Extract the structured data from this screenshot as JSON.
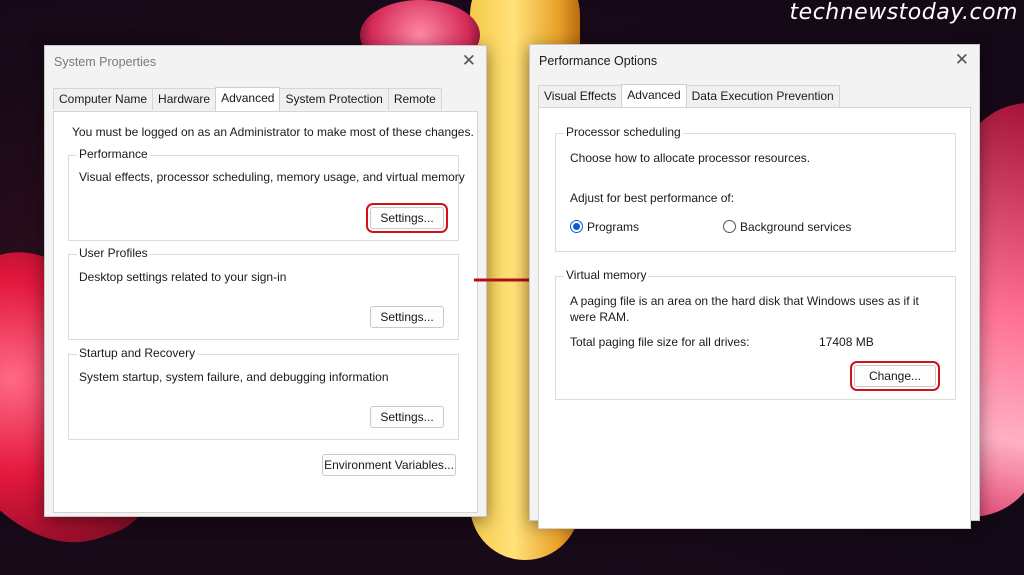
{
  "watermark": "technewstoday.com",
  "left_window": {
    "title": "System Properties",
    "tabs": [
      "Computer Name",
      "Hardware",
      "Advanced",
      "System Protection",
      "Remote"
    ],
    "active_tab": "Advanced",
    "admin_note": "You must be logged on as an Administrator to make most of these changes.",
    "performance": {
      "label": "Performance",
      "description": "Visual effects, processor scheduling, memory usage, and virtual memory",
      "button": "Settings..."
    },
    "user_profiles": {
      "label": "User Profiles",
      "description": "Desktop settings related to your sign-in",
      "button": "Settings..."
    },
    "startup_recovery": {
      "label": "Startup and Recovery",
      "description": "System startup, system failure, and debugging information",
      "button": "Settings..."
    },
    "env_button": "Environment Variables..."
  },
  "right_window": {
    "title": "Performance Options",
    "tabs": [
      "Visual Effects",
      "Advanced",
      "Data Execution Prevention"
    ],
    "active_tab": "Advanced",
    "processor": {
      "label": "Processor scheduling",
      "description": "Choose how to allocate processor resources.",
      "adjust": "Adjust for best performance of:",
      "options": [
        {
          "label": "Programs",
          "selected": true
        },
        {
          "label": "Background services",
          "selected": false
        }
      ]
    },
    "virtual_memory": {
      "label": "Virtual memory",
      "line1": "A paging file is an area on the hard disk that Windows uses as if it",
      "line2": "were RAM.",
      "total_label": "Total paging file size for all drives:",
      "total_value": "17408 MB",
      "button": "Change..."
    }
  },
  "colors": {
    "highlight": "#d0111b",
    "radio_selected": "#0a5bd3"
  }
}
